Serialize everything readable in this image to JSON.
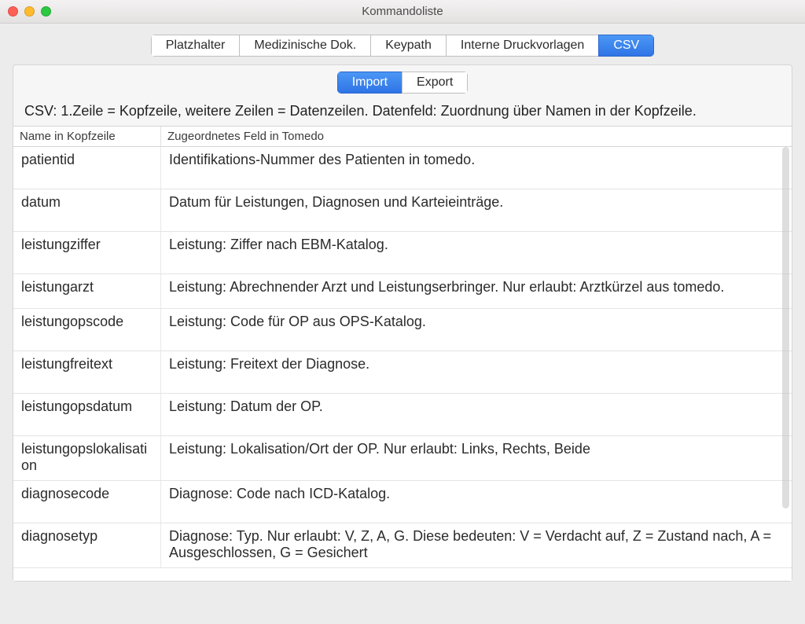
{
  "window": {
    "title": "Kommandoliste"
  },
  "tabs": {
    "items": [
      {
        "label": "Platzhalter"
      },
      {
        "label": "Medizinische Dok."
      },
      {
        "label": "Keypath"
      },
      {
        "label": "Interne Druckvorlagen"
      },
      {
        "label": "CSV"
      }
    ],
    "active_index": 4
  },
  "subtabs": {
    "items": [
      {
        "label": "Import"
      },
      {
        "label": "Export"
      }
    ],
    "active_index": 0
  },
  "info_text": "CSV: 1.Zeile = Kopfzeile, weitere Zeilen = Datenzeilen. Datenfeld: Zuordnung über Namen in der Kopfzeile.",
  "table": {
    "headers": {
      "col1": "Name in Kopfzeile",
      "col2": "Zugeordnetes Feld in Tomedo"
    },
    "rows": [
      {
        "name": "patientid",
        "desc": "Identifikations-Nummer des Patienten in tomedo."
      },
      {
        "name": "datum",
        "desc": "Datum für Leistungen, Diagnosen und Karteieinträge."
      },
      {
        "name": "leistungziffer",
        "desc": "Leistung: Ziffer nach EBM-Katalog."
      },
      {
        "name": "leistungarzt",
        "desc": "Leistung: Abrechnender Arzt und Leistungserbringer. Nur erlaubt: Arztkürzel aus tomedo."
      },
      {
        "name": "leistungopscode",
        "desc": "Leistung: Code für OP aus OPS-Katalog."
      },
      {
        "name": "leistungfreitext",
        "desc": "Leistung: Freitext der Diagnose."
      },
      {
        "name": "leistungopsdatum",
        "desc": "Leistung: Datum der OP."
      },
      {
        "name": "leistungopslokalisation",
        "desc": "Leistung: Lokalisation/Ort der OP. Nur erlaubt: Links, Rechts, Beide"
      },
      {
        "name": "diagnosecode",
        "desc": "Diagnose: Code nach ICD-Katalog."
      },
      {
        "name": "diagnosetyp",
        "desc": "Diagnose: Typ. Nur erlaubt: V, Z, A, G. Diese bedeuten: V = Verdacht auf, Z = Zustand nach, A = Ausgeschlossen, G = Gesichert"
      }
    ]
  }
}
